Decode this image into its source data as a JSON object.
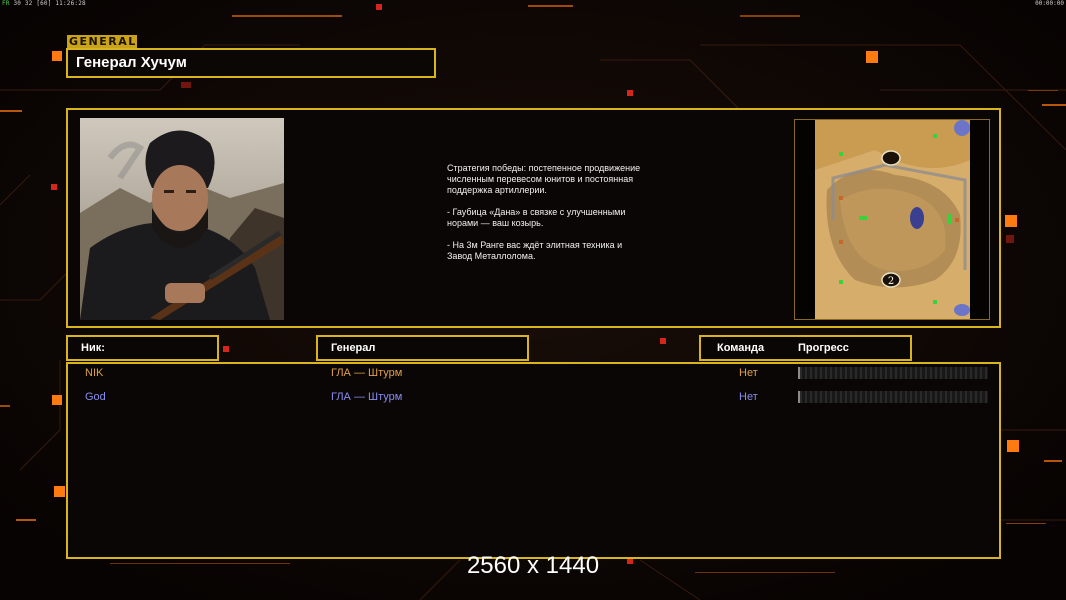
{
  "status": {
    "fps_label": "FR",
    "fps_values": "30 32",
    "fps_cap": "[60]",
    "time": "11:26:28",
    "clock": "00:00:00"
  },
  "header": {
    "tag": "GENERAL",
    "title": "Генерал Хучум"
  },
  "briefing": {
    "paragraphs": [
      "Стратегия победы: постепенное продвижение численным перевесом юнитов и постоянная поддержка артиллерии.",
      "- Гаубица «Дана» в связке с улучшенными норами — ваш козырь.",
      "- На 3м Ранге вас ждёт элитная техника и Завод Металлолома."
    ]
  },
  "minimap": {
    "spawn_bottom": "2"
  },
  "columns": {
    "nick": "Ник:",
    "general": "Генерал",
    "team": "Команда",
    "progress": "Прогресс"
  },
  "players": [
    {
      "nick": "NIK",
      "general": "ГЛА — Штурм",
      "team": "Нет",
      "progress": 0.0,
      "color": "#e0a04a"
    },
    {
      "nick": "God",
      "general": "ГЛА — Штурм",
      "team": "Нет",
      "progress": 0.0,
      "color": "#8a8cf0"
    }
  ],
  "overlay": {
    "resolution": "2560 x 1440"
  },
  "colors": {
    "accent": "#d8b51c",
    "orange": "#ff7a10",
    "background": "#0b0605"
  }
}
